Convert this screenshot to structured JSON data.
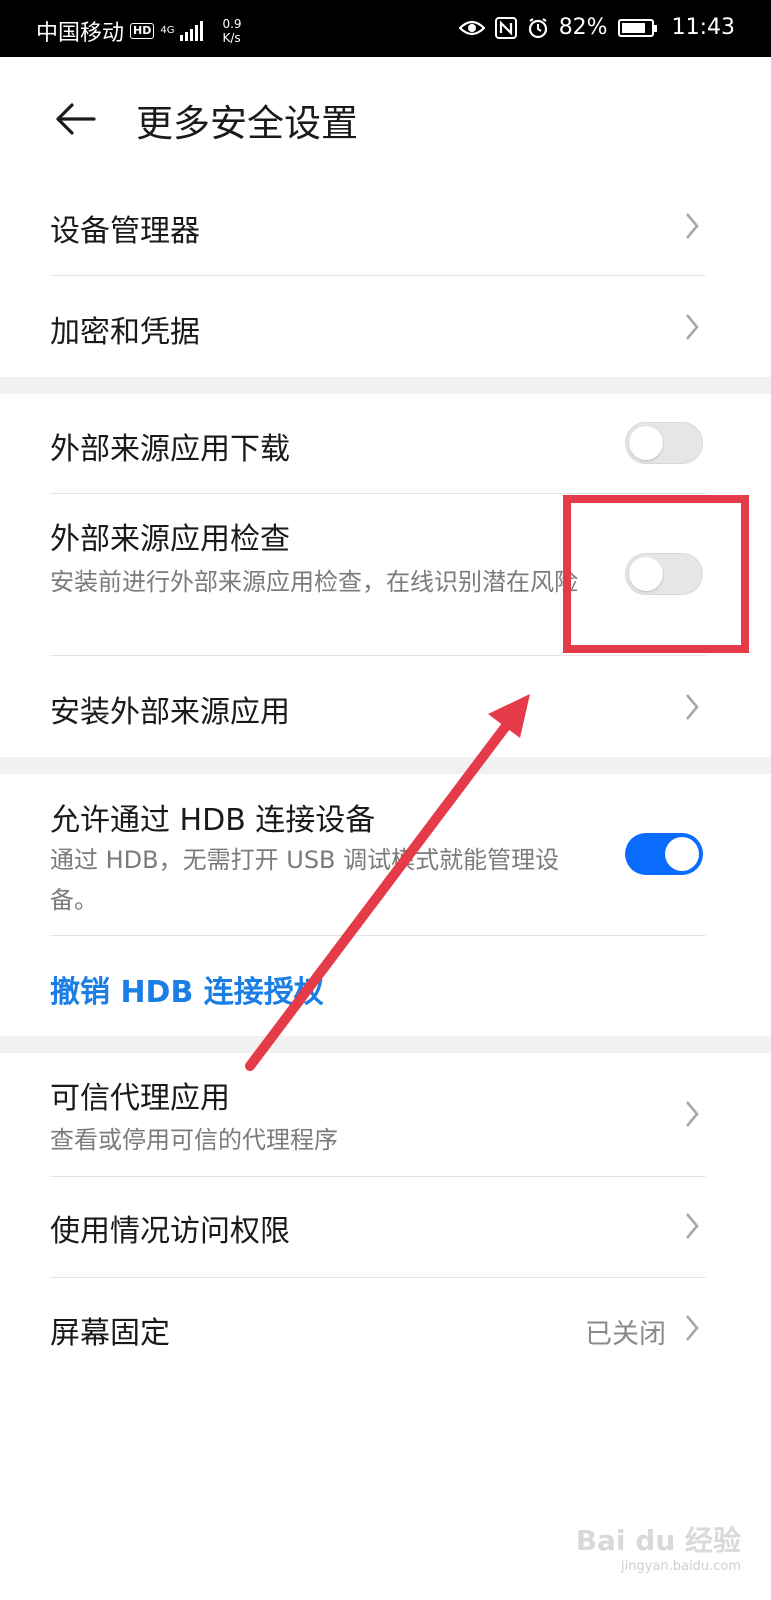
{
  "status_bar": {
    "carrier": "中国移动",
    "hd": "HD",
    "net": "4G",
    "speed_value": "0.9",
    "speed_unit": "K/s",
    "battery": "82%",
    "battery_level": 0.82,
    "time": "11:43",
    "icons": [
      "eye-icon",
      "nfc-icon",
      "alarm-icon",
      "battery-icon",
      "signal-icon"
    ]
  },
  "header": {
    "title": "更多安全设置"
  },
  "items": {
    "device_manager": "设备管理器",
    "encryption": "加密和凭据",
    "external_download": {
      "label": "外部来源应用下载",
      "enabled": false
    },
    "external_check": {
      "label": "外部来源应用检查",
      "sub": "安装前进行外部来源应用检查，在线识别潜在风险",
      "enabled": false
    },
    "install_external": "安装外部来源应用",
    "hdb": {
      "label": "允许通过 HDB 连接设备",
      "sub": "通过 HDB，无需打开 USB 调试模式就能管理设备。",
      "enabled": true
    },
    "revoke_hdb": "撤销 HDB 连接授权",
    "trust_agents": {
      "label": "可信代理应用",
      "sub": "查看或停用可信的代理程序"
    },
    "usage_access": "使用情况访问权限",
    "screen_pinning": {
      "label": "屏幕固定",
      "value": "已关闭"
    }
  },
  "colors": {
    "accent": "#1a7ee6",
    "toggle_on": "#0a6cff",
    "annotation": "#e53a48"
  },
  "watermark": {
    "brand": "Bai du 经验",
    "url": "jingyan.baidu.com"
  }
}
